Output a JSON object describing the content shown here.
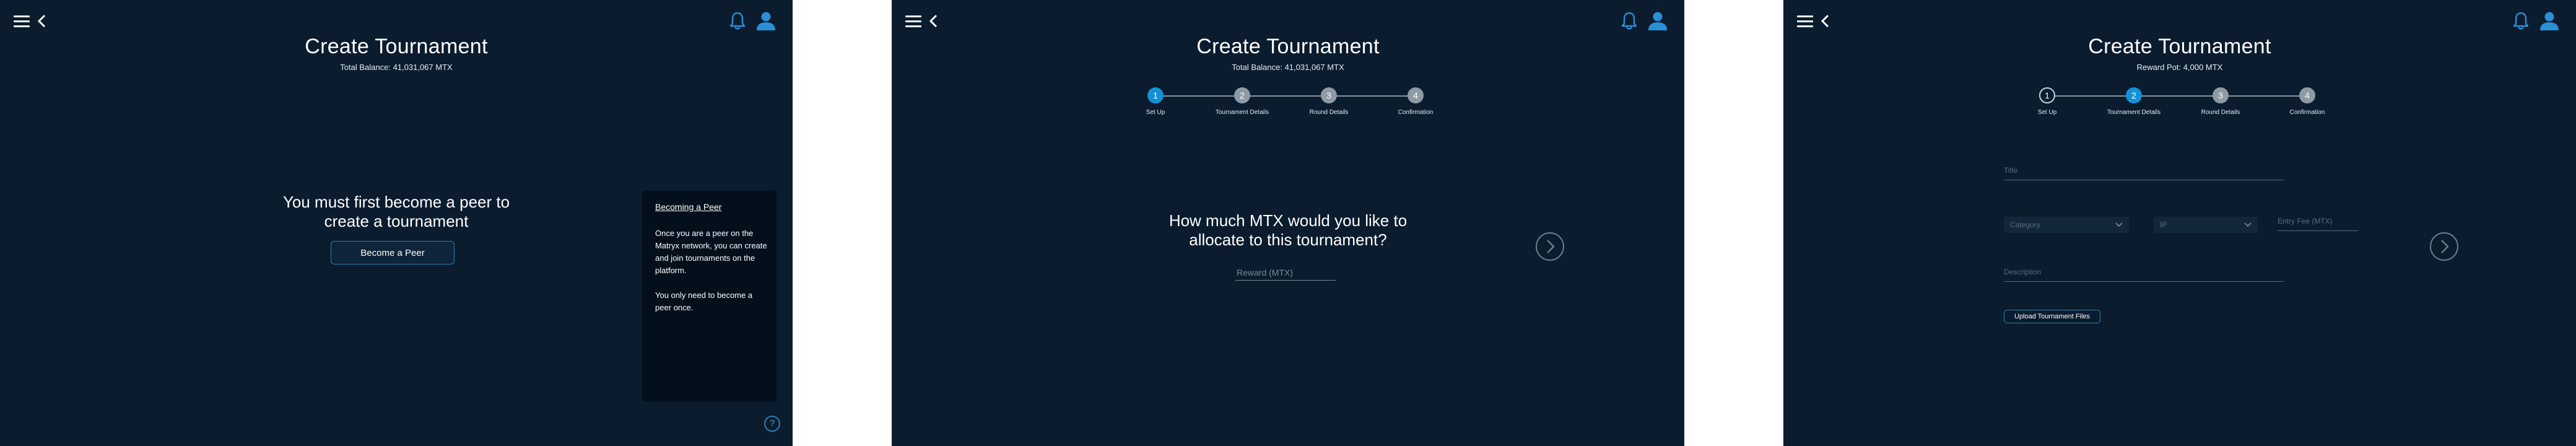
{
  "screens": [
    {
      "header": {
        "title": "Create Tournament",
        "subtitle": "Total Balance: 41,031,067 MTX"
      },
      "message": "You must first become a peer to create a tournament",
      "become_peer_label": "Become a Peer",
      "info_card": {
        "title": "Becoming a Peer",
        "paragraph_1": "Once you are a peer on the Matryx network, you can create and join tournaments on the platform.",
        "paragraph_2": "You only need to become a peer once."
      },
      "help_label": "?"
    },
    {
      "header": {
        "title": "Create Tournament",
        "subtitle": "Total Balance: 41,031,067 MTX"
      },
      "steps": [
        {
          "number": "1",
          "label": "Set Up",
          "state": "active"
        },
        {
          "number": "2",
          "label": "Tournament Details",
          "state": "inactive"
        },
        {
          "number": "3",
          "label": "Round Details",
          "state": "inactive"
        },
        {
          "number": "4",
          "label": "Confirmation",
          "state": "inactive"
        }
      ],
      "question": "How much MTX would you like to allocate to this tournament?",
      "reward_placeholder": "Reward (MTX)"
    },
    {
      "header": {
        "title": "Create Tournament",
        "subtitle": "Reward Pot: 4,000 MTX"
      },
      "steps": [
        {
          "number": "1",
          "label": "Set Up",
          "state": "done"
        },
        {
          "number": "2",
          "label": "Tournament Details",
          "state": "active"
        },
        {
          "number": "3",
          "label": "Round Details",
          "state": "inactive"
        },
        {
          "number": "4",
          "label": "Confirmation",
          "state": "inactive"
        }
      ],
      "form": {
        "title_placeholder": "Title",
        "category_placeholder": "Category",
        "ip_placeholder": "IP",
        "entry_fee_placeholder": "Entry Fee (MTX)",
        "description_placeholder": "Description",
        "upload_label": "Upload Tournament Files"
      }
    }
  ],
  "icons": {
    "menu": "hamburger-menu-icon",
    "back": "chevron-left-icon",
    "notifications": "bell-icon",
    "account": "user-icon",
    "next": "chevron-right-icon",
    "dropdown": "chevron-down-icon"
  },
  "colors": {
    "background": "#0a1c2e",
    "accent": "#1591d6",
    "icon_blue": "#2b8fd6",
    "card": "#03101c",
    "separator": "#ffffff"
  }
}
